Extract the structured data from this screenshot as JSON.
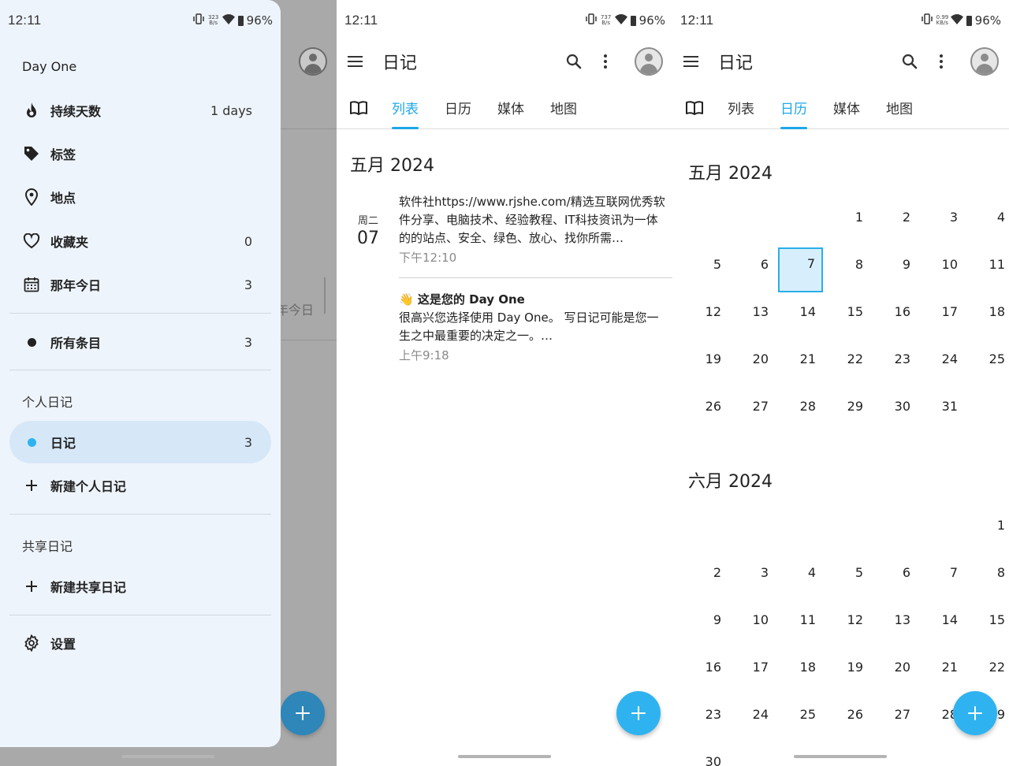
{
  "status_bar": {
    "time": "12:11",
    "speed_left": "323 B/s",
    "speed_mid": "737 B/s",
    "speed_right": "0.99 KB/s",
    "battery": "96%"
  },
  "drawer": {
    "app_name": "Day One",
    "items": [
      {
        "label": "持续天数",
        "count": "1 days",
        "icon": "flame-icon"
      },
      {
        "label": "标签",
        "count": "",
        "icon": "tag-icon"
      },
      {
        "label": "地点",
        "count": "",
        "icon": "location-pin-icon"
      },
      {
        "label": "收藏夹",
        "count": "0",
        "icon": "heart-icon"
      },
      {
        "label": "那年今日",
        "count": "3",
        "icon": "calendar-icon"
      }
    ],
    "all_entries": {
      "label": "所有条目",
      "count": "3"
    },
    "personal_header": "个人日记",
    "journal": {
      "label": "日记",
      "count": "3"
    },
    "new_personal": "新建个人日记",
    "shared_header": "共享日记",
    "new_shared": "新建共享日记",
    "settings": "设置",
    "background_partial_text": "年今日"
  },
  "app": {
    "title": "日记",
    "tabs": [
      "列表",
      "日历",
      "媒体",
      "地图"
    ]
  },
  "list": {
    "month_header": "五月 2024",
    "entry_date": {
      "dow": "周二",
      "dom": "07"
    },
    "entries": [
      {
        "title": "",
        "text": "软件社https://www.rjshe.com/精选互联网优秀软件分享、电脑技术、经验教程、IT科技资讯为一体的的站点、安全、绿色、放心、找你所需…",
        "time": "下午12:10"
      },
      {
        "title": "👋 这是您的 Day One",
        "text": "很高兴您选择使用 Day One。 写日记可能是您一生之中最重要的决定之一。…",
        "time": "上午9:18"
      }
    ]
  },
  "calendar": {
    "months": [
      {
        "label": "五月 2024",
        "offset": 3,
        "days": 31,
        "today": 7
      },
      {
        "label": "六月 2024",
        "offset": 6,
        "days": 30,
        "today": 0
      }
    ]
  },
  "colors": {
    "accent": "#1ea7e8",
    "fab": "#2fb3f0",
    "drawer_bg": "#eef4fb",
    "drawer_active": "#d6e8f7"
  }
}
